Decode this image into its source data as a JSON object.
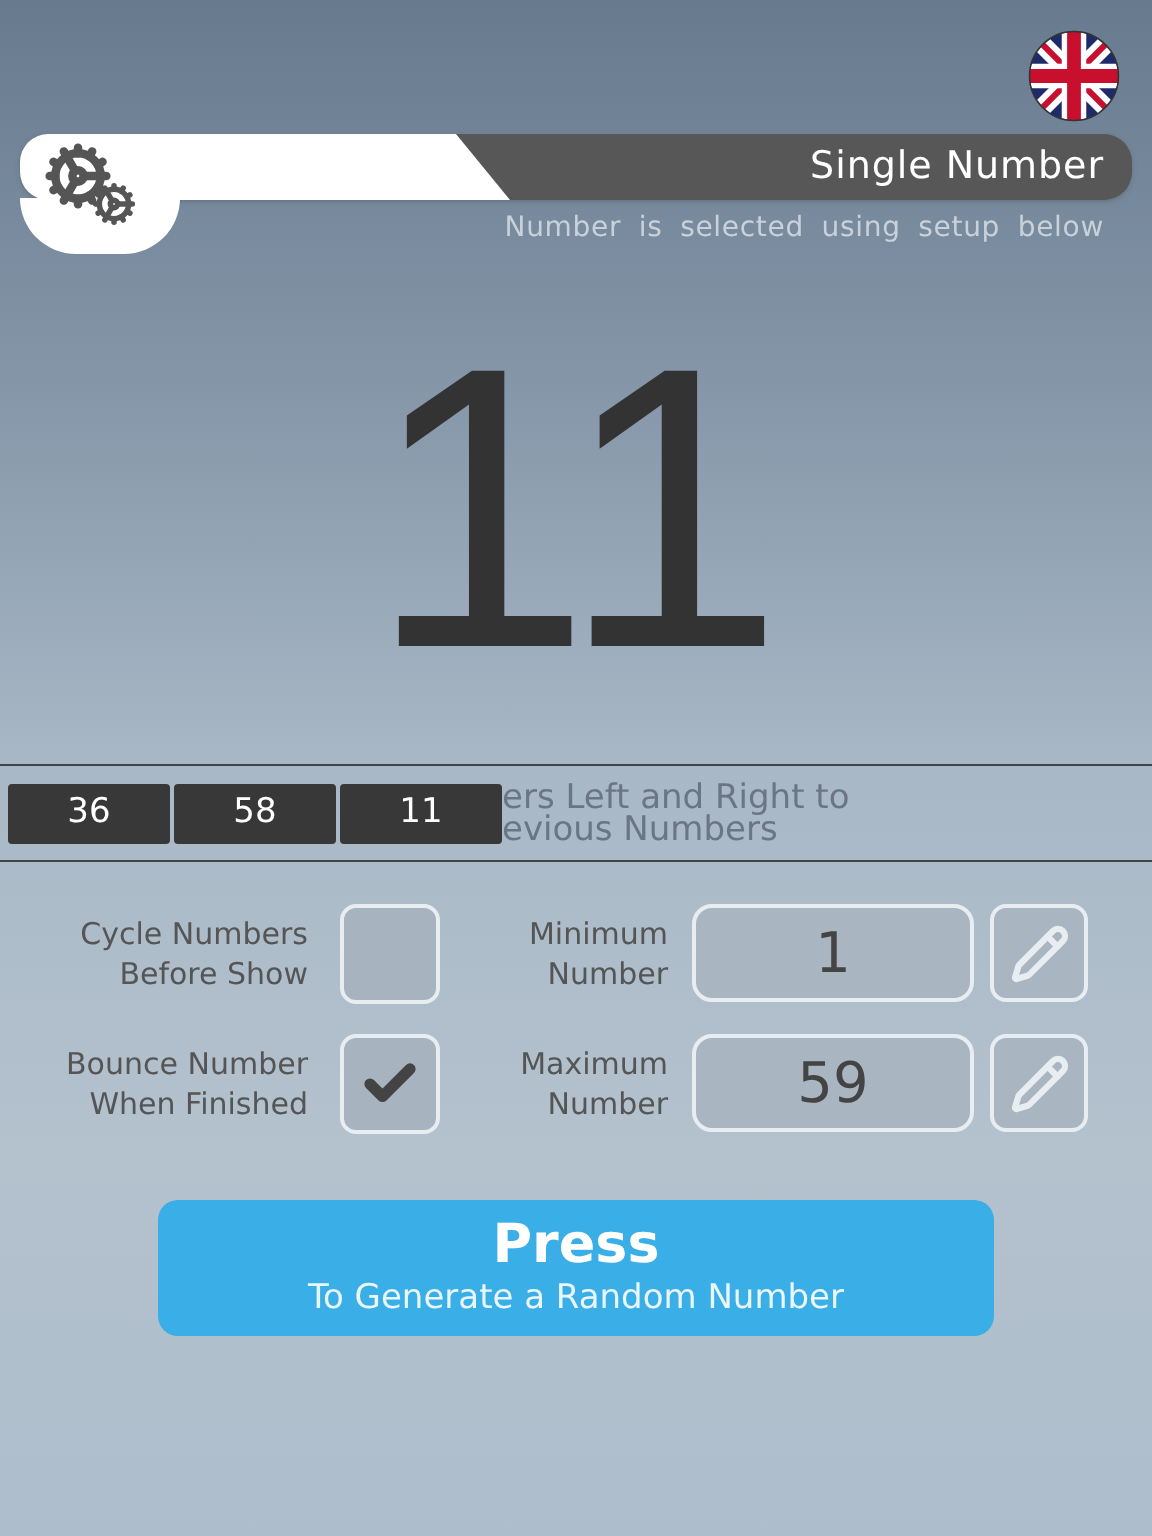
{
  "header": {
    "title": "Single Number",
    "subtitle": "Number is selected using setup below"
  },
  "current_number": "11",
  "history": {
    "numbers": [
      "36",
      "58",
      "11"
    ],
    "hint_lines": [
      "ers Left and Right to",
      "evious Numbers"
    ]
  },
  "options": [
    {
      "label_lines": [
        "Cycle Numbers",
        "Before Show"
      ],
      "checked": false
    },
    {
      "label_lines": [
        "Bounce Number",
        "When Finished"
      ],
      "checked": true
    }
  ],
  "limits": [
    {
      "label_lines": [
        "Minimum",
        "Number"
      ],
      "value": "1"
    },
    {
      "label_lines": [
        "Maximum",
        "Number"
      ],
      "value": "59"
    }
  ],
  "press_button": {
    "title": "Press",
    "caption": "To Generate a Random Number"
  }
}
